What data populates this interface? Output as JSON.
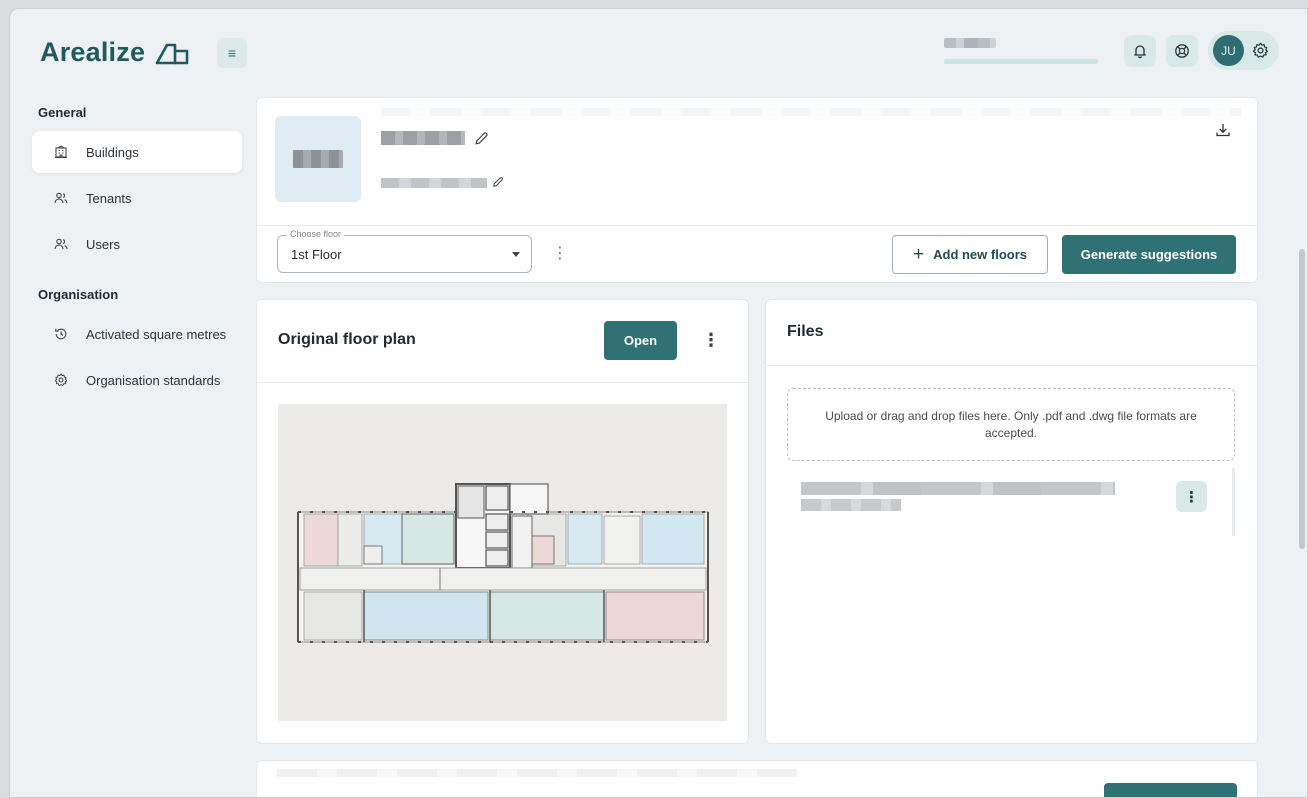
{
  "app": {
    "brand": "Arealize"
  },
  "header": {
    "user_initials": "JU"
  },
  "sidebar": {
    "sections": [
      {
        "heading": "General",
        "items": [
          {
            "label": "Buildings",
            "icon": "building-icon",
            "active": true
          },
          {
            "label": "Tenants",
            "icon": "people-icon",
            "active": false
          },
          {
            "label": "Users",
            "icon": "people-icon",
            "active": false
          }
        ]
      },
      {
        "heading": "Organisation",
        "items": [
          {
            "label": "Activated square metres",
            "icon": "history-icon",
            "active": false
          },
          {
            "label": "Organisation standards",
            "icon": "gear-icon",
            "active": false
          }
        ]
      }
    ]
  },
  "building": {
    "floor_select": {
      "label": "Choose floor",
      "value": "1st Floor"
    },
    "add_floors_label": "Add new floors",
    "generate_label": "Generate suggestions"
  },
  "floor_plan": {
    "title": "Original floor plan",
    "open_label": "Open"
  },
  "files": {
    "title": "Files",
    "dropzone_text": "Upload or drag and drop files here. Only .pdf and .dwg file formats are accepted."
  },
  "colors": {
    "brand": "#1f5b5e",
    "primary_button": "#2f7174",
    "soft_accent": "#d8e9e8",
    "background": "#edf1f4"
  }
}
